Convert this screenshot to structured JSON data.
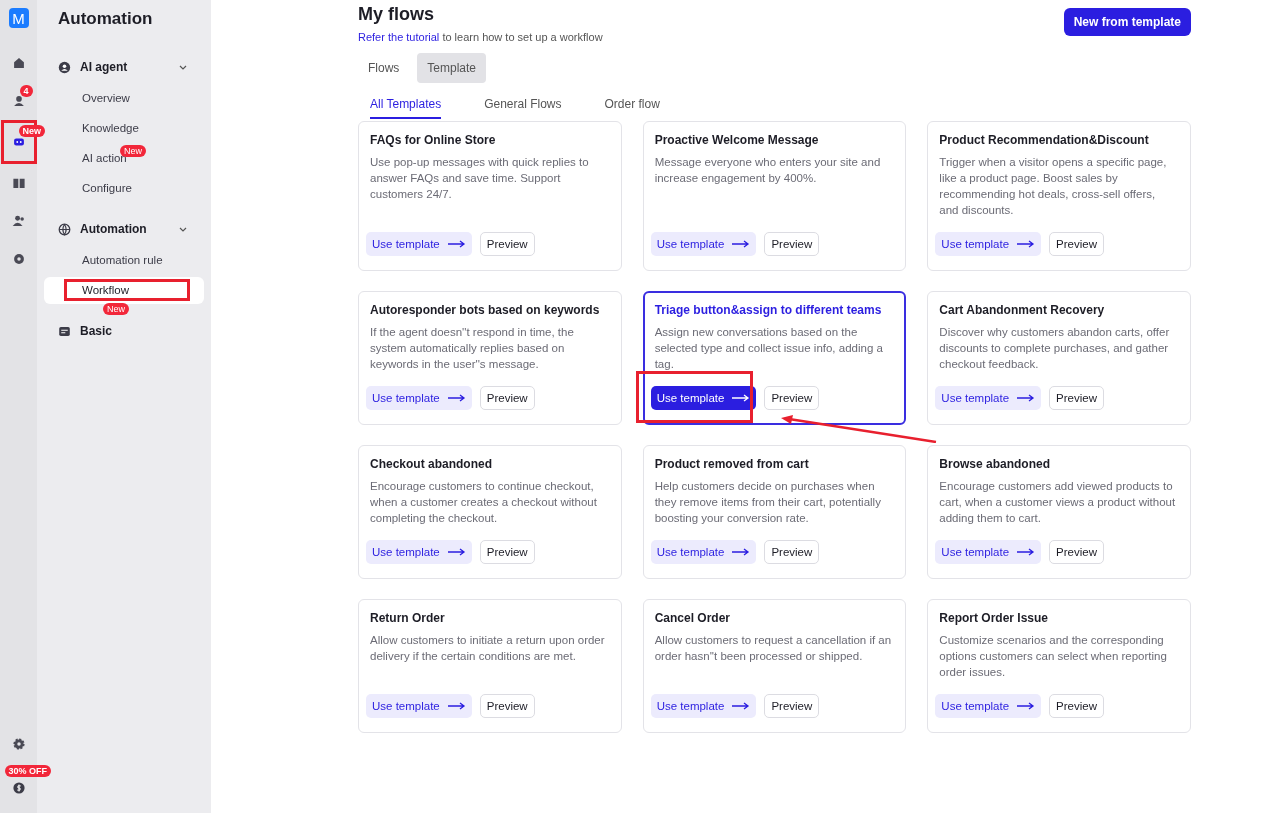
{
  "rail": {
    "logo": "M",
    "items": [
      {
        "kind": "home",
        "selected": false,
        "highlighted": false
      },
      {
        "kind": "chat",
        "selected": false,
        "badge": "4",
        "highlighted": false
      },
      {
        "kind": "bot",
        "selected": true,
        "badge": "New",
        "highlighted": true
      },
      {
        "kind": "book",
        "selected": false,
        "highlighted": false
      },
      {
        "kind": "users",
        "selected": false,
        "highlighted": false
      },
      {
        "kind": "aperture",
        "selected": false,
        "highlighted": false
      }
    ],
    "bottom": [
      {
        "kind": "gear"
      },
      {
        "kind": "dollar",
        "badge": "30% OFF"
      }
    ]
  },
  "sidebar": {
    "title": "Automation",
    "groups": [
      {
        "label": "AI agent",
        "expanded": true,
        "items": [
          {
            "label": "Overview",
            "selected": false,
            "highlighted": false
          },
          {
            "label": "Knowledge",
            "selected": false,
            "highlighted": false
          },
          {
            "label": "AI action",
            "selected": false,
            "badge": "New",
            "highlighted": false
          },
          {
            "label": "Configure",
            "selected": false,
            "highlighted": false
          }
        ]
      },
      {
        "label": "Automation",
        "expanded": true,
        "items": [
          {
            "label": "Automation rule",
            "selected": false,
            "highlighted": false
          },
          {
            "label": "Workflow",
            "selected": true,
            "badge": "New",
            "highlighted": true
          }
        ]
      },
      {
        "label": "Basic",
        "expanded": false
      }
    ]
  },
  "header": {
    "title": "My flows",
    "link": "Refer the tutorial",
    "subtitle": " to learn how to set up a workflow",
    "button": "New from template"
  },
  "tabs": [
    {
      "label": "Flows",
      "selected": false
    },
    {
      "label": "Template",
      "selected": true
    }
  ],
  "subtabs": [
    {
      "label": "All Templates",
      "selected": true
    },
    {
      "label": "General Flows",
      "selected": false
    },
    {
      "label": "Order flow",
      "selected": false
    }
  ],
  "cards": [
    {
      "title": "FAQs for Online Store",
      "description": "Use pop-up messages with quick replies to answer FAQs and save time. Support customers 24/7.",
      "use": "Use template",
      "preview": "Preview",
      "selected": false,
      "highlighted": false
    },
    {
      "title": "Proactive Welcome Message",
      "description": "Message everyone who enters your site and increase engagement by 400%.",
      "use": "Use template",
      "preview": "Preview",
      "selected": false,
      "highlighted": false
    },
    {
      "title": "Product Recommendation&Discount",
      "description": "Trigger when a visitor opens a specific page, like a product page. Boost sales by recommending hot deals, cross-sell offers, and discounts.",
      "use": "Use template",
      "preview": "Preview",
      "selected": false,
      "highlighted": false
    },
    {
      "title": "Autoresponder bots based on keywords",
      "description": "If the agent doesn''t respond in time, the system automatically replies based on keywords in the user''s message.",
      "use": "Use template",
      "preview": "Preview",
      "selected": false,
      "highlighted": false
    },
    {
      "title": "Triage button&assign to different teams",
      "description": "Assign new conversations based on the selected type and collect issue info, adding a tag.",
      "use": "Use template",
      "preview": "Preview",
      "selected": true,
      "highlighted": true
    },
    {
      "title": "Cart Abandonment Recovery",
      "description": "Discover why customers abandon carts, offer discounts to complete purchases, and gather checkout feedback.",
      "use": "Use template",
      "preview": "Preview",
      "selected": false,
      "highlighted": false
    },
    {
      "title": "Checkout abandoned",
      "description": "Encourage customers to continue checkout, when a customer creates a checkout without completing the checkout.",
      "use": "Use template",
      "preview": "Preview",
      "selected": false,
      "highlighted": false
    },
    {
      "title": "Product removed from cart",
      "description": "Help customers decide on purchases when they remove items from their cart, potentially boosting your conversion rate.",
      "use": "Use template",
      "preview": "Preview",
      "selected": false,
      "highlighted": false
    },
    {
      "title": "Browse abandoned",
      "description": "Encourage customers add viewed products to cart, when a customer views a product without adding them to cart.",
      "use": "Use template",
      "preview": "Preview",
      "selected": false,
      "highlighted": false
    },
    {
      "title": "Return Order",
      "description": "Allow customers to initiate a return upon order delivery if the certain conditions are met.",
      "use": "Use template",
      "preview": "Preview",
      "selected": false,
      "highlighted": false
    },
    {
      "title": "Cancel Order",
      "description": "Allow customers to request a cancellation if an order hasn''t been processed or shipped.",
      "use": "Use template",
      "preview": "Preview",
      "selected": false,
      "highlighted": false
    },
    {
      "title": "Report Order Issue",
      "description": "Customize scenarios and the corresponding options customers can select when reporting order issues.",
      "use": "Use template",
      "preview": "Preview",
      "selected": false,
      "highlighted": false
    }
  ]
}
